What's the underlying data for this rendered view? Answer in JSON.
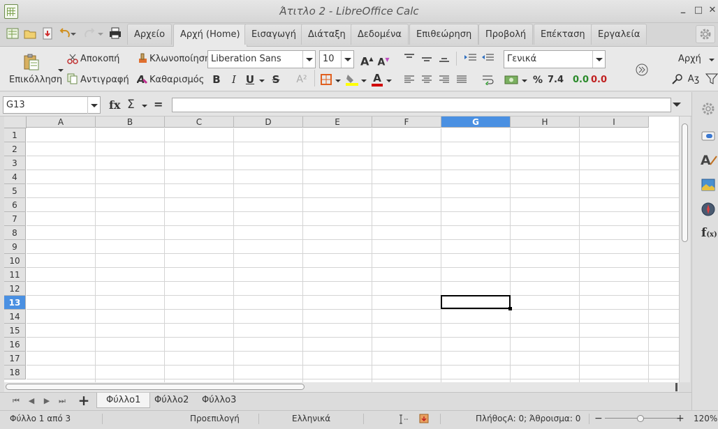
{
  "window": {
    "title": "Άτιτλο 2 - LibreOffice Calc",
    "controls": [
      "_",
      "□",
      "✕"
    ]
  },
  "menu_tabs": [
    {
      "label": "Αρχείο",
      "active": false
    },
    {
      "label": "Αρχή (Home)",
      "active": true
    },
    {
      "label": "Εισαγωγή",
      "active": false
    },
    {
      "label": "Διάταξη",
      "active": false
    },
    {
      "label": "Δεδομένα",
      "active": false
    },
    {
      "label": "Επιθεώρηση",
      "active": false
    },
    {
      "label": "Προβολή",
      "active": false
    },
    {
      "label": "Επέκταση",
      "active": false
    },
    {
      "label": "Εργαλεία",
      "active": false
    }
  ],
  "ribbon": {
    "paste_label": "Επικόλληση",
    "cut_label": "Αποκοπή",
    "copy_label": "Αντιγραφή",
    "clone_label": "Κλωνοποίηση",
    "clear_label": "Καθαρισμός",
    "font_name": "Liberation Sans",
    "font_size": "10",
    "number_format": "Γενικά",
    "percent_label": "%",
    "decimal_label": "7.4",
    "add_decimal_label": "0.0",
    "del_decimal_label": "0.0",
    "styles_label": "Αρχή",
    "bold": "B",
    "italic": "I",
    "underline": "U",
    "strike": "S",
    "superscript": "A²",
    "grow_font": "A",
    "shrink_font": "A",
    "font_color": "A"
  },
  "formula_bar": {
    "cell_ref": "G13",
    "fx": "fx",
    "sum": "Σ",
    "equals": "=",
    "content": ""
  },
  "sheet": {
    "columns": [
      "A",
      "B",
      "C",
      "D",
      "E",
      "F",
      "G",
      "H",
      "I"
    ],
    "selected_column": "G",
    "rows": [
      "1",
      "2",
      "3",
      "4",
      "5",
      "6",
      "7",
      "8",
      "9",
      "10",
      "11",
      "12",
      "13",
      "14",
      "15",
      "16",
      "17",
      "18"
    ],
    "selected_row": "13",
    "active_cell": "G13"
  },
  "sheet_tabs": [
    {
      "label": "Φύλλο1",
      "active": true
    },
    {
      "label": "Φύλλο2",
      "active": false
    },
    {
      "label": "Φύλλο3",
      "active": false
    }
  ],
  "status": {
    "sheet_position": "Φύλλο 1 από 3",
    "page_style": "Προεπιλογή",
    "language": "Ελληνικά",
    "selection_summary": "ΠλήθοςΑ: 0; Άθροισμα: 0",
    "zoom": "120%"
  },
  "colors": {
    "selection_accent": "#4a90e2",
    "grid_line": "#d4d4d4",
    "ribbon_bg": "#e9e9e9"
  }
}
